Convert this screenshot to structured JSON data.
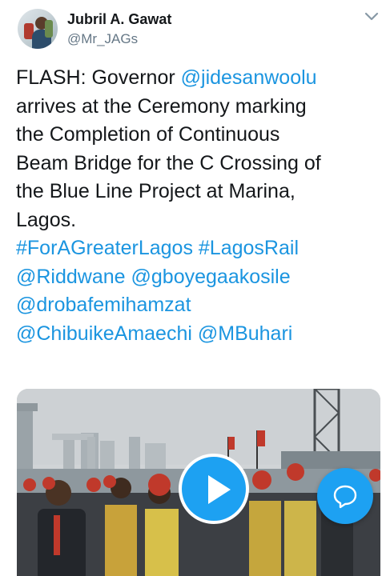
{
  "tweet": {
    "author_name": "Jubril A. Gawat",
    "author_handle": "@Mr_JAGs",
    "lines": [
      [
        {
          "t": "FLASH: Governor "
        },
        {
          "t": "@jidesanwoolu",
          "link": true
        }
      ],
      [
        {
          "t": "arrives at the Ceremony marking"
        }
      ],
      [
        {
          "t": "the Completion of Continuous"
        }
      ],
      [
        {
          "t": "Beam Bridge for the C Crossing of"
        }
      ],
      [
        {
          "t": "the Blue Line Project at Marina,"
        }
      ],
      [
        {
          "t": "Lagos."
        }
      ],
      [
        {
          "t": "#ForAGreaterLagos",
          "link": true
        },
        {
          "t": " "
        },
        {
          "t": "#LagosRail",
          "link": true
        }
      ],
      [
        {
          "t": "@Riddwane",
          "link": true
        },
        {
          "t": " "
        },
        {
          "t": "@gboyegaakosile",
          "link": true
        }
      ],
      [
        {
          "t": "@drobafemihamzat",
          "link": true
        }
      ],
      [
        {
          "t": "@ChibuikeAmaechi",
          "link": true
        },
        {
          "t": " "
        },
        {
          "t": "@MBuhari",
          "link": true
        }
      ]
    ]
  },
  "icons": {
    "more": "chevron-down-icon",
    "play": "play-icon",
    "compose": "speech-bubble-icon"
  },
  "colors": {
    "link": "#1b95e0",
    "accent": "#1da1f2",
    "text": "#14171a",
    "secondary": "#657786"
  }
}
